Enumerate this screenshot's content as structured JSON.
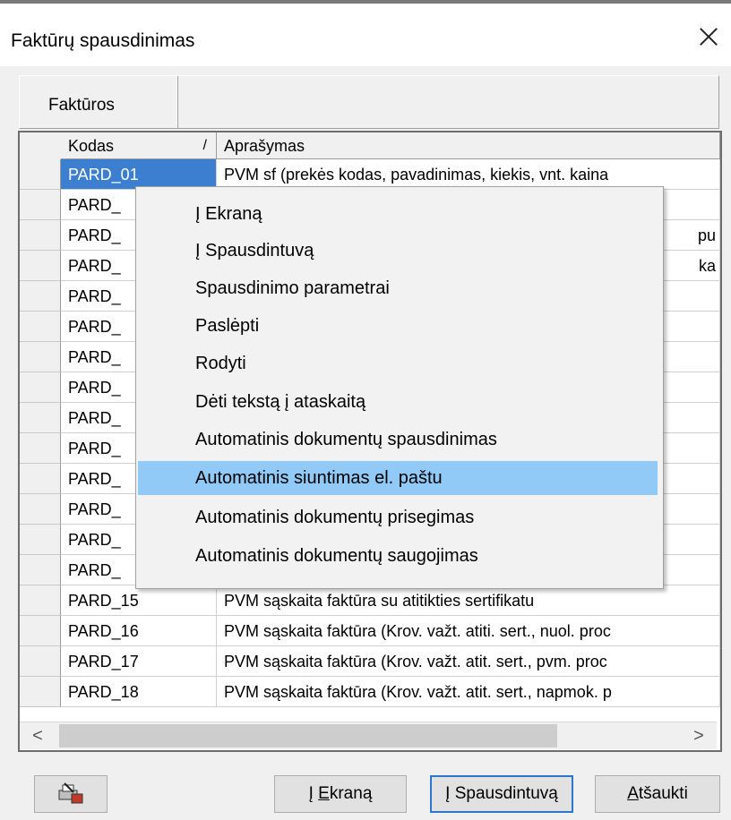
{
  "window": {
    "title": "Faktūrų spausdinimas"
  },
  "tabs": [
    {
      "label": "Faktūros"
    }
  ],
  "grid": {
    "columns": [
      {
        "label": "Kodas",
        "sort_indicator": "/"
      },
      {
        "label": "Aprašymas"
      }
    ],
    "rows": [
      {
        "code": "PARD_01",
        "description": "PVM sf (prekės kodas, pavadinimas, kiekis, vnt. kaina"
      },
      {
        "code": "PARD_",
        "description": ""
      },
      {
        "code": "PARD_",
        "description": "pu"
      },
      {
        "code": "PARD_",
        "description": "ka"
      },
      {
        "code": "PARD_",
        "description": ""
      },
      {
        "code": "PARD_",
        "description": ""
      },
      {
        "code": "PARD_",
        "description": ""
      },
      {
        "code": "PARD_",
        "description": ""
      },
      {
        "code": "PARD_",
        "description": ""
      },
      {
        "code": "PARD_",
        "description": ""
      },
      {
        "code": "PARD_",
        "description": ""
      },
      {
        "code": "PARD_",
        "description": ""
      },
      {
        "code": "PARD_",
        "description": ""
      },
      {
        "code": "PARD_",
        "description": ""
      },
      {
        "code": "PARD_15",
        "description": "PVM sąskaita faktūra su atitikties sertifikatu"
      },
      {
        "code": "PARD_16",
        "description": "PVM sąskaita faktūra (Krov. važt. atiti. sert., nuol. proc"
      },
      {
        "code": "PARD_17",
        "description": "PVM sąskaita faktūra (Krov. važt. atit. sert., pvm. proc"
      },
      {
        "code": "PARD_18",
        "description": "PVM sąskaita faktūra (Krov. važt. atit. sert., napmok. p"
      }
    ],
    "scroll_left": "<",
    "scroll_right": ">"
  },
  "context_menu": {
    "items": [
      {
        "label": "Į Ekraną"
      },
      {
        "label": "Į Spausdintuvą"
      },
      {
        "label": "Spausdinimo parametrai"
      },
      {
        "label": "Paslėpti"
      },
      {
        "label": "Rodyti"
      },
      {
        "label": "Dėti tekstą į ataskaitą"
      },
      {
        "label": "Automatinis dokumentų spausdinimas"
      },
      {
        "label": "Automatinis siuntimas el. paštu",
        "highlighted": true
      },
      {
        "label": "Automatinis dokumentų prisegimas"
      },
      {
        "label": "Automatinis dokumentų saugojimas"
      }
    ]
  },
  "footer": {
    "icon_button": "print-settings-icon",
    "to_screen_prefix": "Į ",
    "to_screen_key": "E",
    "to_screen_rest": "kraną",
    "to_printer": "Į Spausdintuvą",
    "cancel_key": "A",
    "cancel_rest": "tšaukti"
  },
  "colors": {
    "selection": "#3c7fd0",
    "menu_highlight": "#91c9f7",
    "default_button_border": "#2b77cf"
  }
}
